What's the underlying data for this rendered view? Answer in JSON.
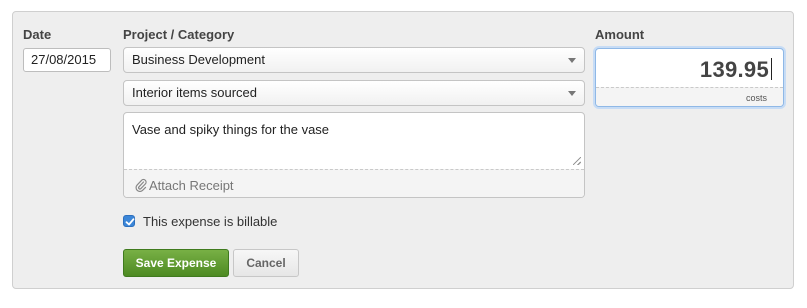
{
  "form": {
    "date_label": "Date",
    "date_value": "27/08/2015",
    "project_label": "Project / Category",
    "project_value": "Business Development",
    "category_value": "Interior items sourced",
    "description_value": "Vase and spiky things for the vase",
    "attach_label": "Attach Receipt",
    "amount_label": "Amount",
    "amount_value": "139.95",
    "amount_sub_label": "costs",
    "billable_label": "This expense is billable",
    "billable_checked": true,
    "save_label": "Save Expense",
    "cancel_label": "Cancel"
  },
  "icons": {
    "attach": "paperclip-icon",
    "select_caret": "caret-down-icon",
    "check": "check-icon"
  },
  "colors": {
    "save_button": "#5a9630",
    "checkbox": "#3b86d8",
    "amount_focus": "#8fb8e6"
  }
}
